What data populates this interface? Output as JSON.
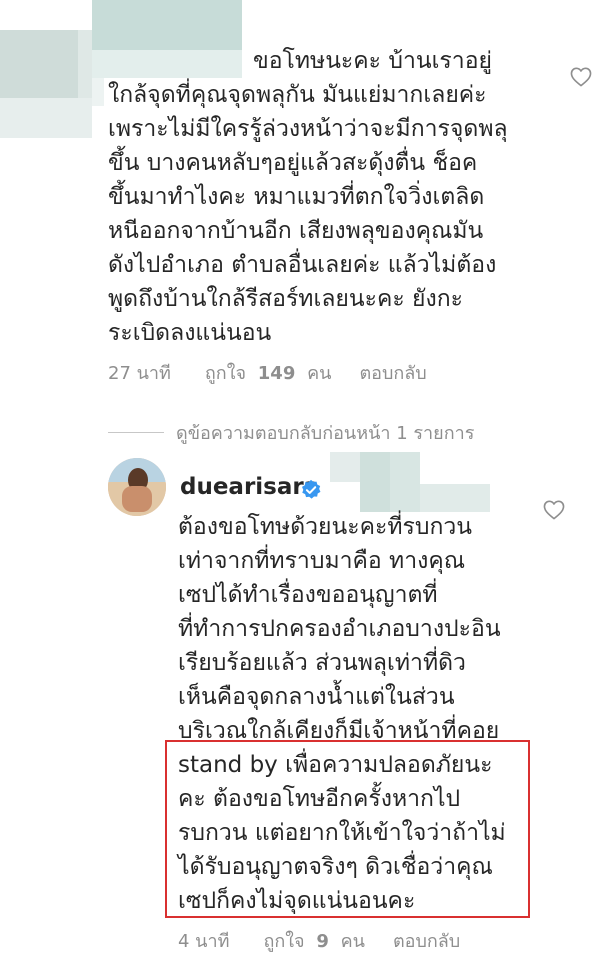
{
  "comment": {
    "lines": [
      "ขอโทษนะคะ บ้านเราอยู่",
      "ใกล้จุดที่คุณจุดพลุกัน มันแย่มากเลยค่ะ",
      "เพราะไม่มีใครรู้ล่วงหน้าว่าจะมีการจุดพลุ",
      "ขึ้น บางคนหลับๆอยู่แล้วสะดุ้งตื่น ช็อค",
      "ขึ้นมาทำไงคะ หมาแมวที่ตกใจวิ่งเตลิด",
      "หนีออกจากบ้านอีก เสียงพลุของคุณมัน",
      "ดังไปอำเภอ ตำบลอื่นเลยค่ะ แล้วไม่ต้อง",
      "พูดถึงบ้านใกล้รีสอร์ทเลยนะคะ ยังกะ",
      "ระเบิดลงแน่นอน"
    ],
    "time": "27 นาที",
    "likes_label": "ถูกใจ",
    "likes_count": "149",
    "likes_unit": "คน",
    "reply_label": "ตอบกลับ",
    "like_icon": "heart-outline-icon"
  },
  "view_replies": {
    "label": "ดูข้อความตอบกลับก่อนหน้า 1 รายการ"
  },
  "reply": {
    "username": "duearisara",
    "verified_icon": "verified-badge-icon",
    "lines": [
      "ต้องขอโทษด้วยนะคะที่รบกวน",
      "เท่าจากที่ทราบมาคือ ทางคุณ",
      "เซปได้ทำเรื่องขออนุญาตที่",
      "ที่ทำการปกครองอำเภอบางปะอิน",
      "เรียบร้อยแล้ว ส่วนพลุเท่าที่ดิว",
      "เห็นคือจุดกลางน้ำแต่ในส่วน",
      "บริเวณใกล้เคียงก็มีเจ้าหน้าที่คอย",
      "stand by เพื่อความปลอดภัยนะ",
      "คะ ต้องขอโทษอีกครั้งหากไป",
      "รบกวน แต่อยากให้เข้าใจว่าถ้าไม่",
      "ได้รับอนุญาตจริงๆ ดิวเชื่อว่าคุณ",
      "เซปก็คงไม่จุดแน่นอนคะ"
    ],
    "time": "4 นาที",
    "likes_label": "ถูกใจ",
    "likes_count": "9",
    "likes_unit": "คน",
    "reply_label": "ตอบกลับ"
  },
  "colors": {
    "text": "#262626",
    "meta": "#8e8e8e",
    "verified": "#3897f0",
    "highlight": "#d93030"
  }
}
